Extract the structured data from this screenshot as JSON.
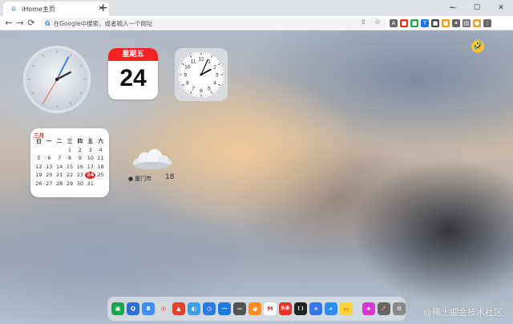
{
  "tab": {
    "title": "iHome主页",
    "close_glyph": "✕"
  },
  "window": {
    "minimize": "—",
    "maximize": "☐",
    "close": "✕",
    "tab_search": "⌄"
  },
  "toolbar": {
    "back": "←",
    "forward": "→",
    "reload": "⟳",
    "omnibox_icon": "G",
    "omnibox_placeholder": "在Google中搜索，或者输入一个网址",
    "share_glyph": "⇪",
    "star_glyph": "☆",
    "extensions": [
      {
        "icon": "translate-icon",
        "color": "#6b6b6b",
        "glyph": "A"
      },
      {
        "icon": "extension-red-icon",
        "color": "#d9362b",
        "glyph": "■"
      },
      {
        "icon": "extension-green-icon",
        "color": "#2f9d57",
        "glyph": "■"
      },
      {
        "icon": "filter-icon",
        "color": "#1a73e8",
        "glyph": "T"
      },
      {
        "icon": "extension-dark-icon",
        "color": "#444",
        "glyph": "■"
      },
      {
        "icon": "extension-orange-icon",
        "color": "#f29b1d",
        "glyph": "■"
      },
      {
        "icon": "puzzle-icon",
        "color": "#666",
        "glyph": "✦"
      },
      {
        "icon": "reading-list-icon",
        "color": "#777",
        "glyph": "▤"
      },
      {
        "icon": "profile-icon",
        "color": "#e8a23a",
        "glyph": "●"
      },
      {
        "icon": "menu-icon",
        "color": "#666",
        "glyph": "⋮"
      }
    ]
  },
  "widgets": {
    "weekday": "星期五",
    "day": "24",
    "analog_big": {
      "hour": 2,
      "minute": 4,
      "second": 35
    },
    "analog_small": {
      "hour": 2,
      "minute": 4
    },
    "emoji": "🤣"
  },
  "calendar": {
    "month": "三月",
    "weekdays": [
      "日",
      "一",
      "二",
      "三",
      "四",
      "五",
      "六"
    ],
    "days": [
      "",
      "",
      "",
      "1",
      "2",
      "3",
      "4",
      "5",
      "6",
      "7",
      "8",
      "9",
      "10",
      "11",
      "12",
      "13",
      "14",
      "15",
      "16",
      "17",
      "18",
      "19",
      "20",
      "21",
      "22",
      "23",
      "24",
      "25",
      "26",
      "27",
      "28",
      "29",
      "30",
      "31",
      ""
    ],
    "today": "24"
  },
  "weather": {
    "location": "厦门市",
    "temperature": "18",
    "location_icon": "📍"
  },
  "dock": {
    "apps": [
      {
        "name": "files-app-icon",
        "color": "#19a34a",
        "glyph": "▣"
      },
      {
        "name": "qq-app-icon",
        "color": "#2b6fd8",
        "glyph": "Q"
      },
      {
        "name": "bilibili-app-icon",
        "color": "#3e8ef7",
        "glyph": "B"
      },
      {
        "name": "chrome-app-icon",
        "color": "#d9d9d9",
        "glyph": "◎"
      },
      {
        "name": "gitlab-app-icon",
        "color": "#e24329",
        "glyph": "▲"
      },
      {
        "name": "browser-app-icon",
        "color": "#3aa0e8",
        "glyph": "◐"
      },
      {
        "name": "clock-app-icon",
        "color": "#2a7ae2",
        "glyph": "◷"
      },
      {
        "name": "more-app-icon",
        "color": "#1e7be0",
        "glyph": "⋯"
      },
      {
        "name": "dots-app-icon",
        "color": "#555",
        "glyph": "—"
      },
      {
        "name": "orange-app-icon",
        "color": "#ff8a1f",
        "glyph": "◕"
      },
      {
        "name": "gmail-app-icon",
        "color": "#ffffff",
        "glyph": "M"
      },
      {
        "name": "toutiao-app-icon",
        "color": "#e8332b",
        "glyph": "头条"
      },
      {
        "name": "bracket-app-icon",
        "color": "#222",
        "glyph": "[ ]"
      },
      {
        "name": "plus-app-icon",
        "color": "#3576e8",
        "glyph": "+"
      },
      {
        "name": "search-app-icon",
        "color": "#2d8cf0",
        "glyph": "⌕"
      },
      {
        "name": "notes-app-icon",
        "color": "#ffd43b",
        "glyph": "▭"
      }
    ],
    "pinned": [
      {
        "name": "star-app-icon",
        "color": "#d63ad1",
        "glyph": "★"
      },
      {
        "name": "launchpad-app-icon",
        "color": "#666",
        "glyph": "🚀"
      },
      {
        "name": "settings-app-icon",
        "color": "#888",
        "glyph": "⚙"
      }
    ]
  },
  "watermark": "@稀土掘金技术社区"
}
